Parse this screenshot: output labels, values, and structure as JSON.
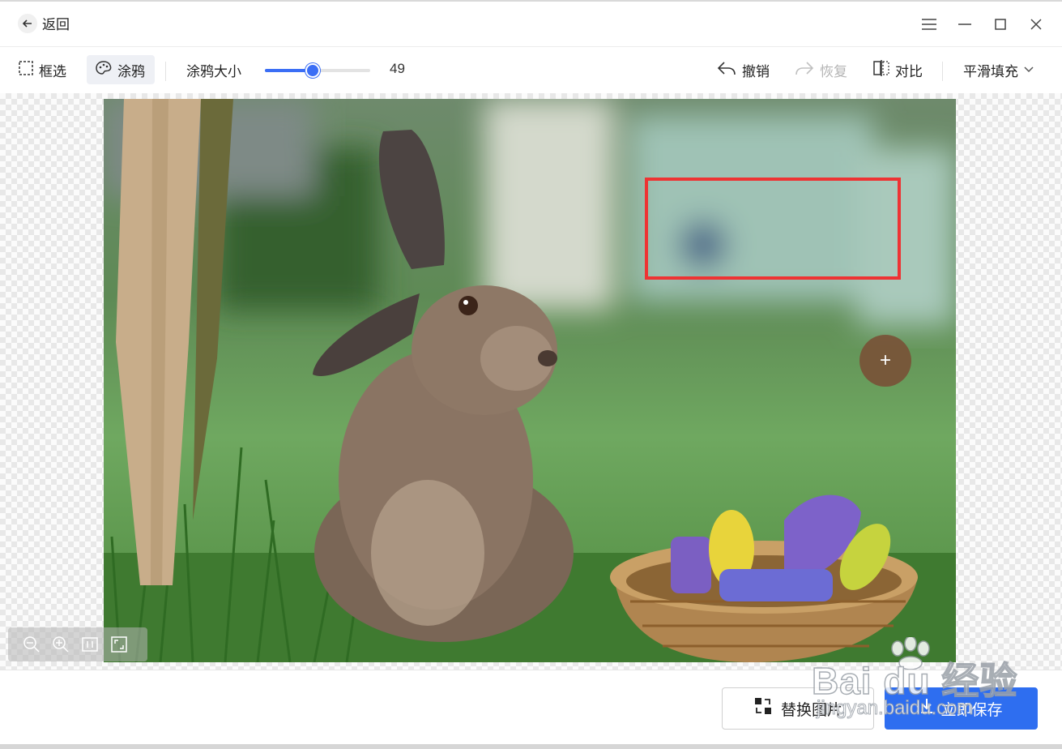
{
  "titlebar": {
    "back_label": "返回",
    "icons": [
      "arrow-left-icon",
      "menu-icon",
      "minimize-icon",
      "maximize-icon",
      "close-icon"
    ]
  },
  "toolbar": {
    "box_select_label": "框选",
    "brush_label": "涂鸦",
    "brush_size_label": "涂鸦大小",
    "brush_size_value": "49",
    "brush_size_fraction": 0.45,
    "undo_label": "撤销",
    "redo_label": "恢复",
    "compare_label": "对比",
    "fill_mode_label": "平滑填充"
  },
  "bottom": {
    "replace_label": "替换图片",
    "save_label": "立即保存"
  },
  "watermark": {
    "logo": "Bai du 经验",
    "url": "jingyan.baidu.com"
  },
  "colors": {
    "accent": "#2e6ef0",
    "selection": "#ee3333",
    "brush_cursor": "#785237"
  }
}
